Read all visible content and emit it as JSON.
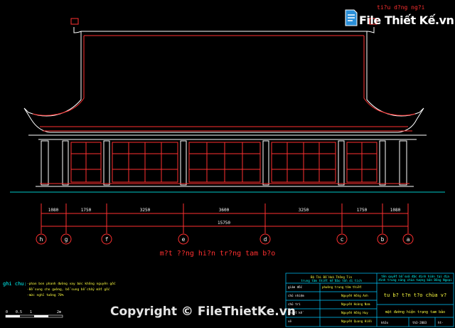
{
  "corner_text": "ti?u d?ng ng?i",
  "brand": {
    "name": "File Thiết Kế.vn"
  },
  "dimensions": {
    "top": [
      "1080",
      "1750",
      "3250",
      "3600",
      "3250",
      "1750",
      "1080"
    ],
    "total": "15750"
  },
  "axes": [
    "h",
    "g",
    "f",
    "e",
    "d",
    "c",
    "b",
    "a"
  ],
  "drawing_title": "m?t ??ng hi?n tr?ng tam b?o",
  "notes": {
    "title": "ghi chu:",
    "lines": [
      "-phan bon phanh đường vay bức không nguyên gốc",
      "-Bổ sung cho gường, bổ sung bổ chấy mất gốc",
      "-mức nghỉ tường 70%"
    ]
  },
  "scale": [
    "0",
    "0.5",
    "1",
    "2m"
  ],
  "title_block": {
    "left_head": [
      "Bộ Tài Đồ Hoá Thông Tin",
      "trung tâm thiết kế Bảo tồn di tích"
    ],
    "roles": [
      "giám đốc",
      "chủ nhiệm",
      "chủ trì",
      "thiết kế",
      "vẽ"
    ],
    "names": [
      "phường trung tâm thiết",
      "Nguyễn Hồng Anh",
      "Nguyễn Hoàng Nam",
      "Nguyễn Hồng Huy",
      "Nguyễn Quang Hiền"
    ],
    "project": [
      "tên quyết bổ sửa đặc định hiện tại địa",
      "đình trung năng chùa tượng bản Đông Ngoại"
    ],
    "sheet_title": "tu b? t?n t?o chùa v?",
    "drawing_name": "mặt đường hiện trạng tam bảo",
    "code": "kh3x",
    "date": "th3-2003",
    "sheet": "ht-"
  },
  "watermark": "Copyright © FileThietKe.vn"
}
